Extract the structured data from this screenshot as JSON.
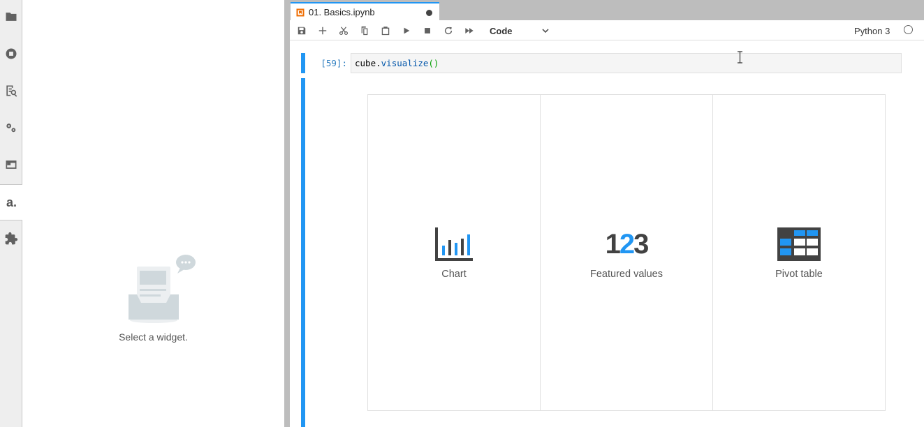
{
  "activity_bar": {
    "items": [
      {
        "icon": "folder-icon"
      },
      {
        "icon": "running-icon"
      },
      {
        "icon": "commands-icon"
      },
      {
        "icon": "property-inspector-icon"
      },
      {
        "icon": "tabs-icon"
      },
      {
        "icon": "atoti-logo-icon",
        "label": "a."
      },
      {
        "icon": "extensions-icon"
      }
    ]
  },
  "side_panel": {
    "empty_text": "Select a widget."
  },
  "notebook": {
    "tab_label": "01. Basics.ipynb",
    "cell_type": "Code",
    "kernel_name": "Python 3",
    "cells": [
      {
        "prompt": "[59]:",
        "code_obj": "cube",
        "code_dot": ".",
        "code_fn": "visualize",
        "code_parens": "()"
      }
    ]
  },
  "widget_picker": {
    "options": [
      {
        "label": "Chart",
        "icon": "chart-icon"
      },
      {
        "label": "Featured values",
        "icon": "featured-values-icon",
        "glyph_a": "1",
        "glyph_b": "2",
        "glyph_c": "3"
      },
      {
        "label": "Pivot table",
        "icon": "pivot-table-icon"
      }
    ]
  },
  "colors": {
    "accent": "#2196f3",
    "dark_icon": "#424242"
  }
}
